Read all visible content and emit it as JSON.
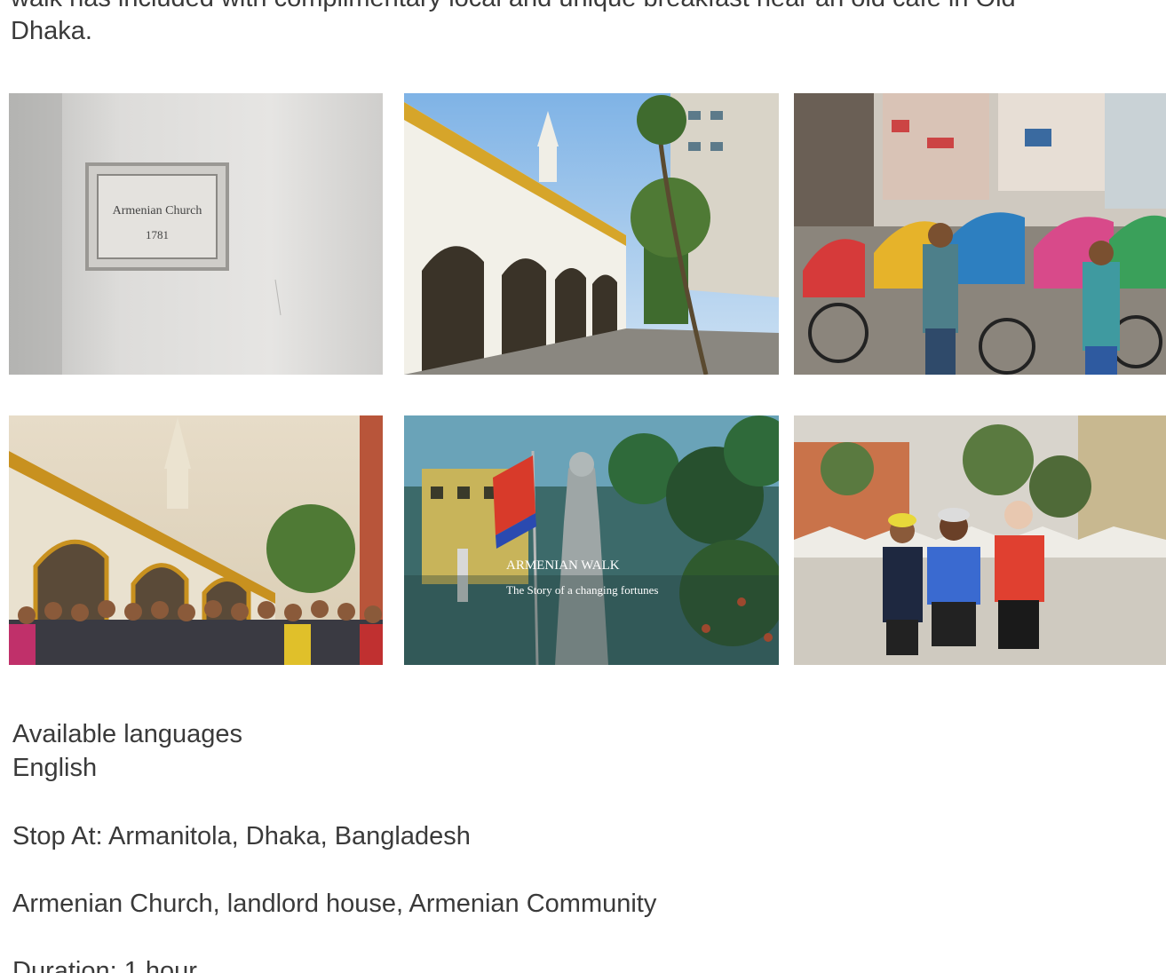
{
  "intro": {
    "text_line1": "walk has included with complimentary local and unique breakfast near an old café in Old",
    "text_line2": "Dhaka."
  },
  "gallery": {
    "photos": [
      {
        "icon": "church-plaque-photo",
        "plaque_line1": "Armenian Church",
        "plaque_line2": "1781"
      },
      {
        "icon": "church-arcade-photo"
      },
      {
        "icon": "rickshaw-street-photo"
      },
      {
        "icon": "group-at-church-photo"
      },
      {
        "icon": "armenian-walk-poster-photo",
        "poster_title": "ARMENIAN WALK",
        "poster_subtitle": "The Story of a changing fortunes"
      },
      {
        "icon": "cyclists-photo"
      }
    ]
  },
  "details": {
    "languages_label": "Available languages",
    "languages_value": "English",
    "stop_at": "Stop At: Armanitola, Dhaka, Bangladesh",
    "places": "Armenian Church, landlord house, Armenian Community",
    "duration": "Duration: 1 hour"
  }
}
